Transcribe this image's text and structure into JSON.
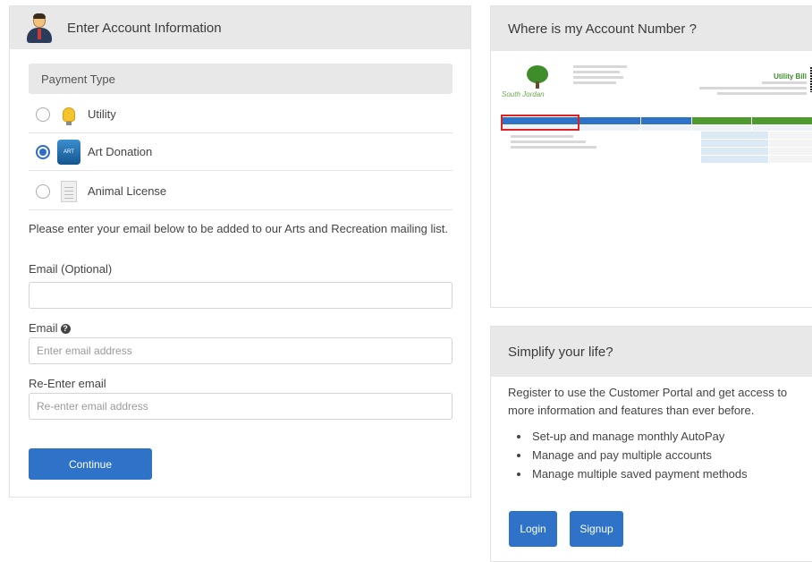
{
  "left_panel": {
    "title": "Enter Account Information",
    "avatar_icon": "user-avatar-icon",
    "payment_type_label": "Payment Type",
    "options": [
      {
        "label": "Utility",
        "icon": "lightbulb-icon",
        "selected": false
      },
      {
        "label": "Art Donation",
        "icon": "art-donation-icon",
        "selected": true
      },
      {
        "label": "Animal License",
        "icon": "document-icon",
        "selected": false
      }
    ],
    "note": "Please enter your email below to be added to our Arts and Recreation mailing list.",
    "email_optional_label": "Email (Optional)",
    "email_optional_value": "",
    "email_label": "Email",
    "email_placeholder": "Enter email address",
    "reenter_label": "Re-Enter email",
    "reenter_placeholder": "Re-enter email address",
    "continue_label": "Continue"
  },
  "right_top": {
    "title": "Where is my Account Number ?",
    "bill_brand": "South Jordan",
    "bill_title": "Utility Bill",
    "colors": {
      "table_head": "#2f73c9",
      "table_green": "#4e9a2f",
      "highlight": "#dd2222"
    }
  },
  "right_bottom": {
    "title": "Simplify your life?",
    "intro": "Register to use the Customer Portal and get access to more information and features than ever before.",
    "bullets": [
      "Set-up and manage monthly AutoPay",
      "Manage and pay multiple accounts",
      "Manage multiple saved payment methods"
    ],
    "login_label": "Login",
    "signup_label": "Signup"
  },
  "colors": {
    "accent": "#2f73c9",
    "header_bg": "#e8e8e8"
  }
}
